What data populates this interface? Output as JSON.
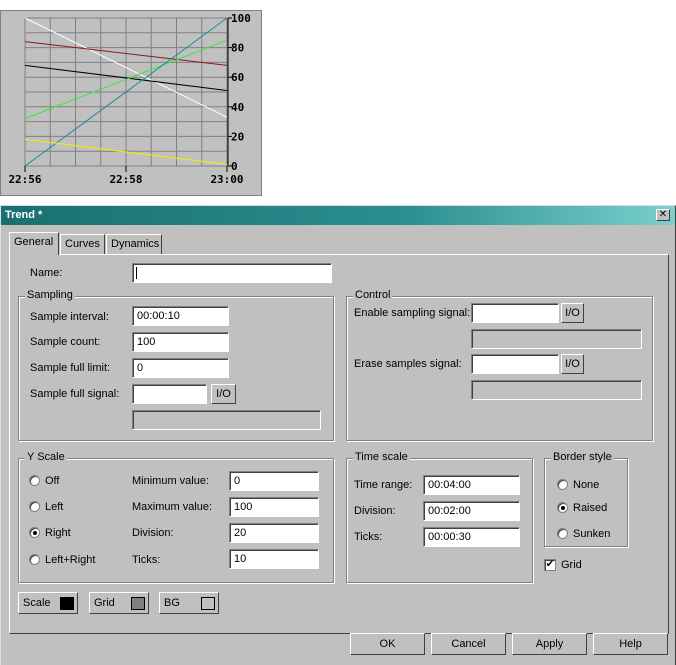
{
  "preview": {
    "chart_data": {
      "type": "line",
      "x_tick_labels": [
        "22:56",
        "22:58",
        "23:00"
      ],
      "y_tick_labels": [
        "0",
        "20",
        "40",
        "60",
        "80",
        "100"
      ],
      "ylim": [
        0,
        100
      ],
      "grid": true,
      "background": "#c0c0c0",
      "grid_color": "#808080",
      "x": [
        0,
        1
      ],
      "series": [
        {
          "color": "#ffffff",
          "values": [
            100,
            33
          ]
        },
        {
          "color": "#8b1a1a",
          "values": [
            84,
            68
          ]
        },
        {
          "color": "#000000",
          "values": [
            68,
            51
          ]
        },
        {
          "color": "#38e838",
          "values": [
            32,
            85
          ]
        },
        {
          "color": "#1a8a9a",
          "values": [
            0,
            100
          ]
        },
        {
          "color": "#f0f000",
          "values": [
            18,
            1
          ]
        }
      ]
    }
  },
  "dialog": {
    "title": "Trend *",
    "close_glyph": "✕",
    "tabs": [
      {
        "label": "General",
        "active": true
      },
      {
        "label": "Curves",
        "active": false
      },
      {
        "label": "Dynamics",
        "active": false
      }
    ],
    "name_label": "Name:",
    "name_value": "",
    "sampling": {
      "title": "Sampling",
      "interval_label": "Sample interval:",
      "interval_value": "00:00:10",
      "count_label": "Sample count:",
      "count_value": "100",
      "full_limit_label": "Sample full limit:",
      "full_limit_value": "0",
      "full_signal_label": "Sample full signal:",
      "full_signal_value": "",
      "io_label": "I/O"
    },
    "control": {
      "title": "Control",
      "enable_label": "Enable sampling signal:",
      "enable_value": "",
      "erase_label": "Erase samples signal:",
      "erase_value": "",
      "io_label": "I/O"
    },
    "yscale": {
      "title": "Y Scale",
      "options": [
        {
          "label": "Off",
          "selected": false
        },
        {
          "label": "Left",
          "selected": false
        },
        {
          "label": "Right",
          "selected": true
        },
        {
          "label": "Left+Right",
          "selected": false
        }
      ],
      "min_label": "Minimum value:",
      "min_value": "0",
      "max_label": "Maximum value:",
      "max_value": "100",
      "division_label": "Division:",
      "division_value": "20",
      "ticks_label": "Ticks:",
      "ticks_value": "10"
    },
    "timescale": {
      "title": "Time scale",
      "range_label": "Time range:",
      "range_value": "00:04:00",
      "division_label": "Division:",
      "division_value": "00:02:00",
      "ticks_label": "Ticks:",
      "ticks_value": "00:00:30"
    },
    "border": {
      "title": "Border style",
      "options": [
        {
          "label": "None",
          "selected": false
        },
        {
          "label": "Raised",
          "selected": true
        },
        {
          "label": "Sunken",
          "selected": false
        }
      ]
    },
    "grid_label": "Grid",
    "grid_checked": true,
    "check_glyph": "✔",
    "colors": [
      {
        "label": "Scale",
        "color": "#000000"
      },
      {
        "label": "Grid",
        "color": "#808080"
      },
      {
        "label": "BG",
        "color": "#c0c0c0"
      }
    ],
    "buttons": {
      "ok": "OK",
      "cancel": "Cancel",
      "apply": "Apply",
      "help": "Help"
    }
  }
}
